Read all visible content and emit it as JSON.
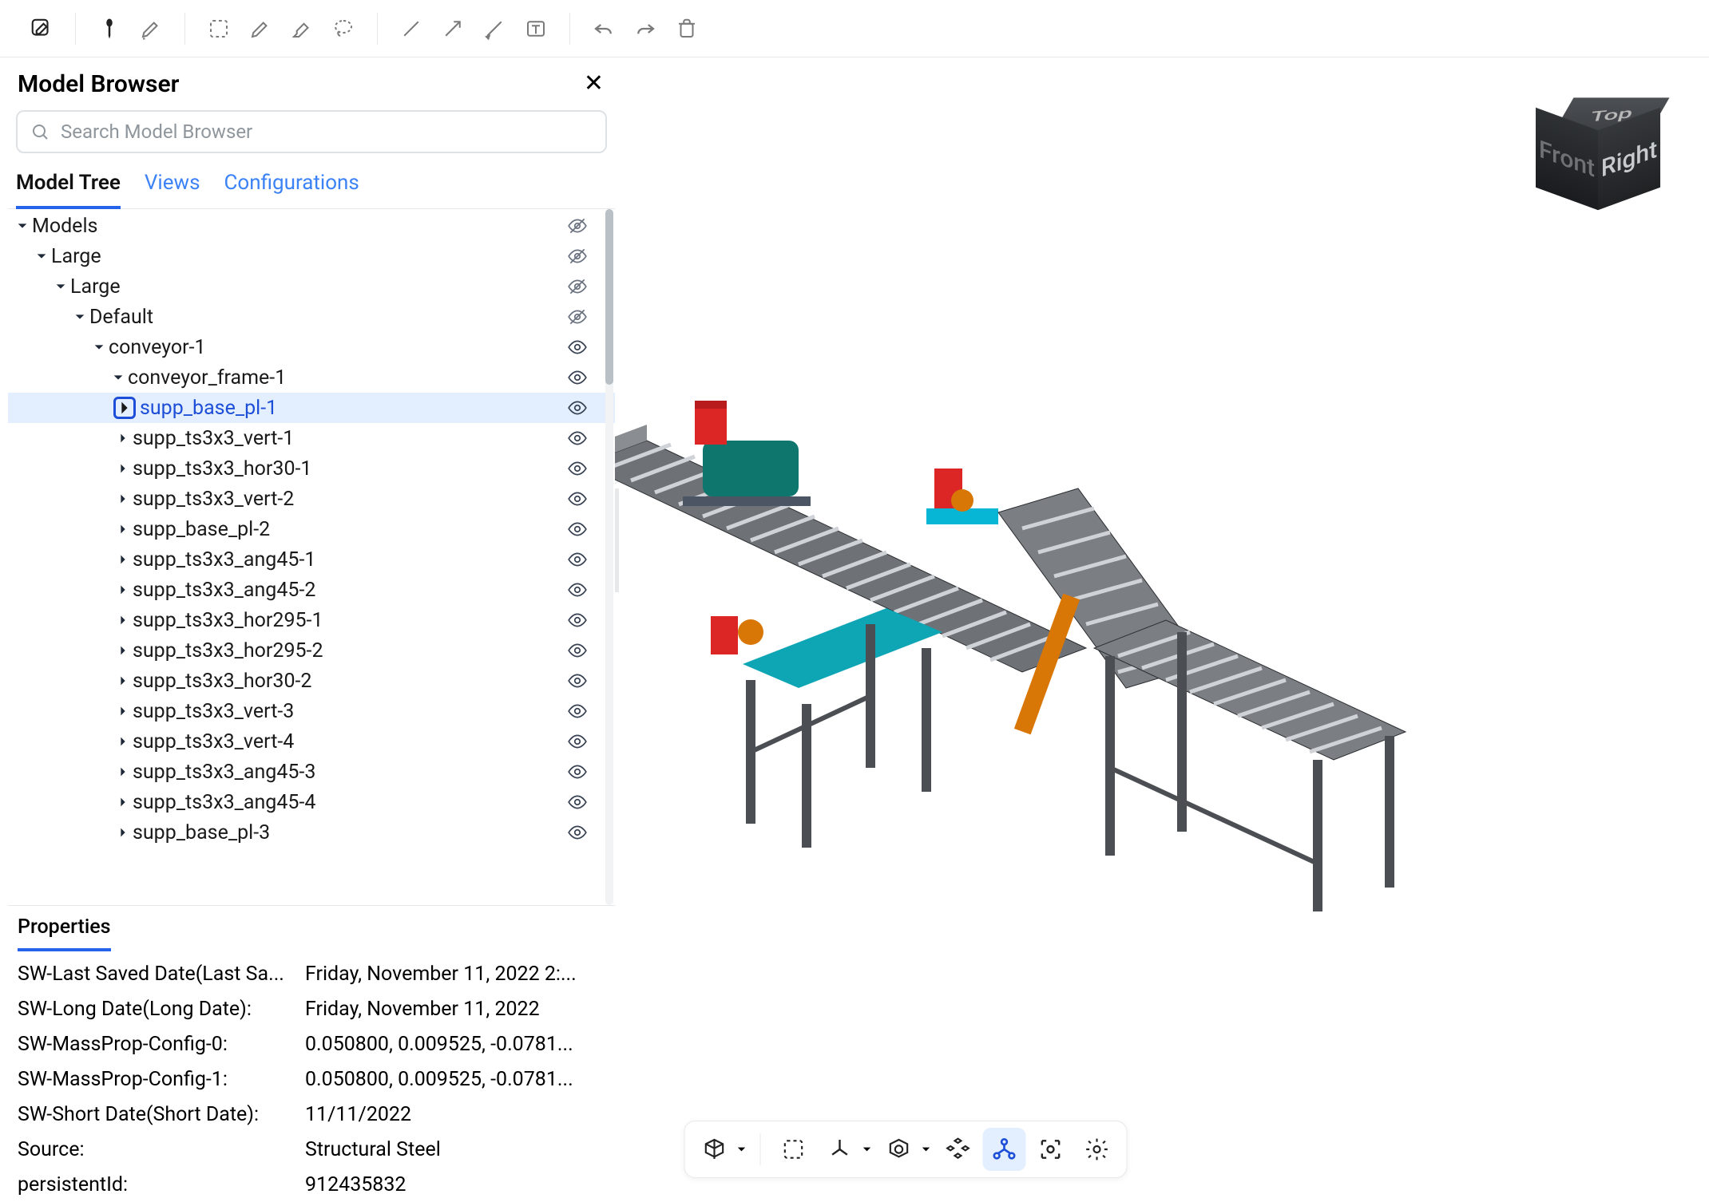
{
  "panel": {
    "title": "Model Browser",
    "search_placeholder": "Search Model Browser",
    "tabs": [
      "Model Tree",
      "Views",
      "Configurations"
    ],
    "active_tab": "Model Tree",
    "properties_label": "Properties"
  },
  "tree": [
    {
      "label": "Models",
      "indent": 0,
      "expanded": true,
      "eye": "crossed"
    },
    {
      "label": "Large",
      "indent": 1,
      "expanded": true,
      "eye": "crossed"
    },
    {
      "label": "Large",
      "indent": 2,
      "expanded": true,
      "eye": "crossed"
    },
    {
      "label": "Default",
      "indent": 3,
      "expanded": true,
      "eye": "crossed"
    },
    {
      "label": "conveyor-1",
      "indent": 4,
      "expanded": true,
      "eye": "open"
    },
    {
      "label": "conveyor_frame-1",
      "indent": 5,
      "expanded": true,
      "eye": "open"
    },
    {
      "label": "supp_base_pl-1",
      "indent": 6,
      "expanded": false,
      "eye": "open",
      "selected": true
    },
    {
      "label": "supp_ts3x3_vert-1",
      "indent": 6,
      "expanded": false,
      "eye": "open"
    },
    {
      "label": "supp_ts3x3_hor30-1",
      "indent": 6,
      "expanded": false,
      "eye": "open"
    },
    {
      "label": "supp_ts3x3_vert-2",
      "indent": 6,
      "expanded": false,
      "eye": "open"
    },
    {
      "label": "supp_base_pl-2",
      "indent": 6,
      "expanded": false,
      "eye": "open"
    },
    {
      "label": "supp_ts3x3_ang45-1",
      "indent": 6,
      "expanded": false,
      "eye": "open"
    },
    {
      "label": "supp_ts3x3_ang45-2",
      "indent": 6,
      "expanded": false,
      "eye": "open"
    },
    {
      "label": "supp_ts3x3_hor295-1",
      "indent": 6,
      "expanded": false,
      "eye": "open"
    },
    {
      "label": "supp_ts3x3_hor295-2",
      "indent": 6,
      "expanded": false,
      "eye": "open"
    },
    {
      "label": "supp_ts3x3_hor30-2",
      "indent": 6,
      "expanded": false,
      "eye": "open"
    },
    {
      "label": "supp_ts3x3_vert-3",
      "indent": 6,
      "expanded": false,
      "eye": "open"
    },
    {
      "label": "supp_ts3x3_vert-4",
      "indent": 6,
      "expanded": false,
      "eye": "open"
    },
    {
      "label": "supp_ts3x3_ang45-3",
      "indent": 6,
      "expanded": false,
      "eye": "open"
    },
    {
      "label": "supp_ts3x3_ang45-4",
      "indent": 6,
      "expanded": false,
      "eye": "open"
    },
    {
      "label": "supp_base_pl-3",
      "indent": 6,
      "expanded": false,
      "eye": "open",
      "truncated": true
    }
  ],
  "properties": [
    {
      "k": "SW-Last Saved Date(Last Sa...",
      "v": "Friday, November 11, 2022 2:..."
    },
    {
      "k": "SW-Long Date(Long Date):",
      "v": "Friday, November 11, 2022"
    },
    {
      "k": "SW-MassProp-Config-0:",
      "v": "0.050800, 0.009525, -0.0781..."
    },
    {
      "k": "SW-MassProp-Config-1:",
      "v": "0.050800, 0.009525, -0.0781..."
    },
    {
      "k": "SW-Short Date(Short Date):",
      "v": "11/11/2022"
    },
    {
      "k": "Source:",
      "v": "Structural Steel"
    },
    {
      "k": "persistentId:",
      "v": "912435832"
    }
  ],
  "viewcube": {
    "top": "Top",
    "front": "Front",
    "right": "Right"
  }
}
